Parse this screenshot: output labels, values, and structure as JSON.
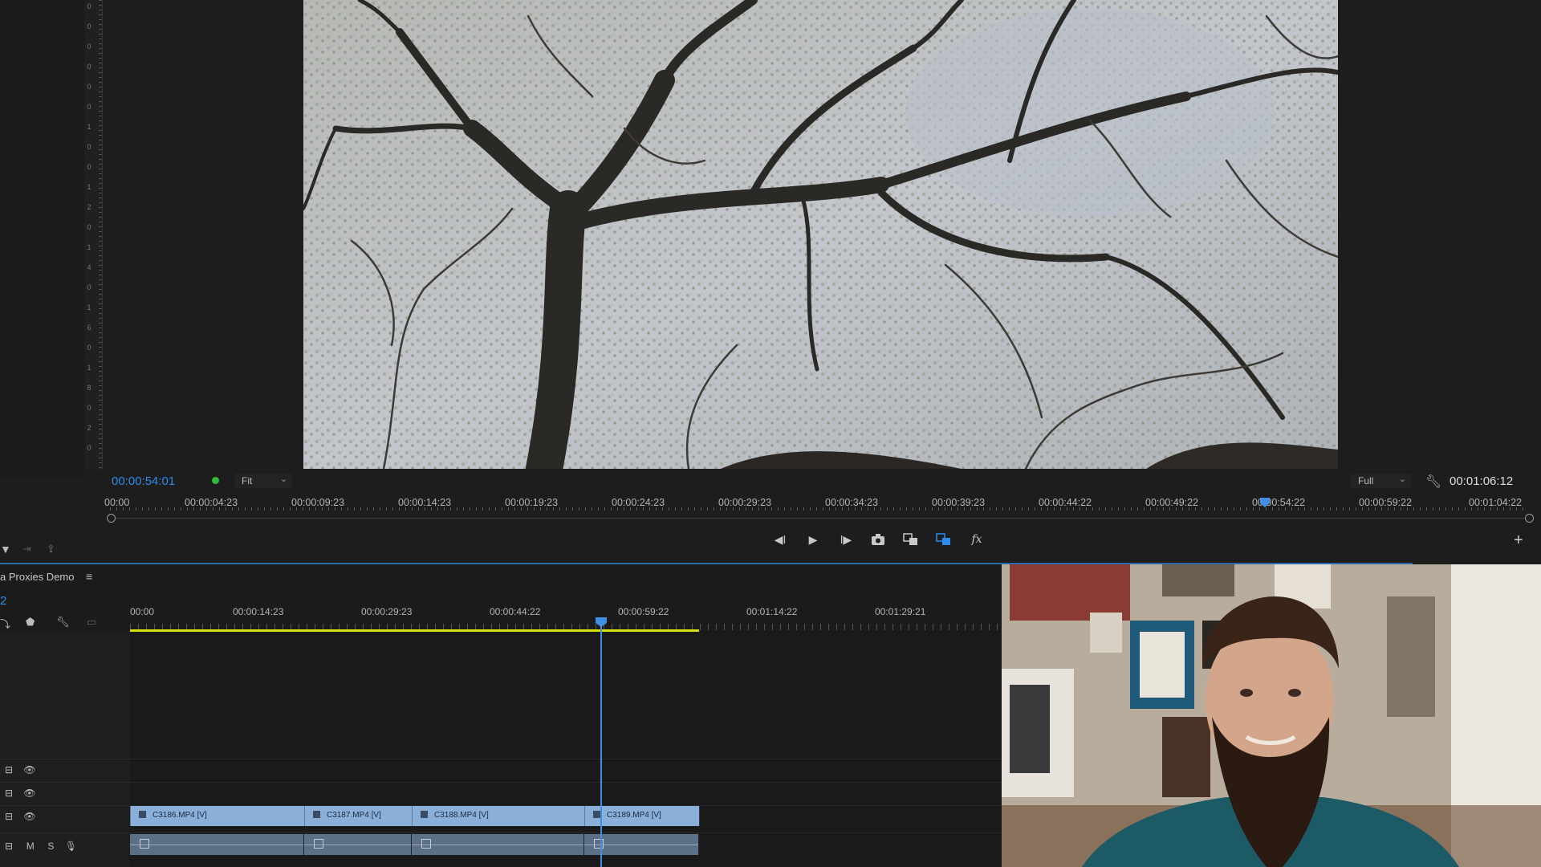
{
  "program_monitor": {
    "current_timecode": "00:00:54:01",
    "zoom_select": "Fit",
    "resolution_select": "Full",
    "duration_timecode": "00:01:06:12",
    "ruler_labels": [
      "00:00",
      "00:00:04:23",
      "00:00:09:23",
      "00:00:14:23",
      "00:00:19:23",
      "00:00:24:23",
      "00:00:29:23",
      "00:00:34:23",
      "00:00:39:23",
      "00:00:44:22",
      "00:00:49:22",
      "00:00:54:22",
      "00:00:59:22",
      "00:01:04:22"
    ],
    "vertical_ruler": [
      "0",
      "0",
      "0",
      "0",
      "0",
      "0",
      "1",
      "0",
      "0",
      "1",
      "2",
      "0",
      "1",
      "4",
      "0",
      "1",
      "6",
      "0",
      "1",
      "8",
      "0",
      "2",
      "0"
    ]
  },
  "transport": {
    "step_back_icon": "step-back-icon",
    "play_icon": "play-icon",
    "step_forward_icon": "step-forward-icon",
    "camera_icon": "export-frame-icon",
    "overlay_icon": "comparison-view-icon",
    "proxy_icon": "toggle-proxies-icon",
    "fx_label": "fx",
    "add_icon": "plus-icon"
  },
  "timeline": {
    "sequence_name": "a Proxies Demo",
    "sequence_timecode": "2",
    "ruler_labels": [
      "00:00",
      "00:00:14:23",
      "00:00:29:23",
      "00:00:44:22",
      "00:00:59:22",
      "00:01:14:22",
      "00:01:29:21"
    ],
    "tracks": [
      {
        "type": "video",
        "icons": [
          "track-icon",
          "eye-icon"
        ]
      },
      {
        "type": "video",
        "icons": [
          "track-icon",
          "eye-icon"
        ]
      },
      {
        "type": "video",
        "icons": [
          "track-icon",
          "eye-icon"
        ]
      },
      {
        "type": "audio",
        "m": "M",
        "s": "S"
      }
    ],
    "video_clips": [
      "C3186.MP4 [V]",
      "C3187.MP4 [V]",
      "C3188.MP4 [V]",
      "C3189.MP4 [V]"
    ]
  },
  "colors": {
    "accent_blue": "#2d8ceb",
    "work_area": "#d6e000",
    "clip_video": "#8aafd8",
    "clip_audio": "#5b6f86"
  }
}
